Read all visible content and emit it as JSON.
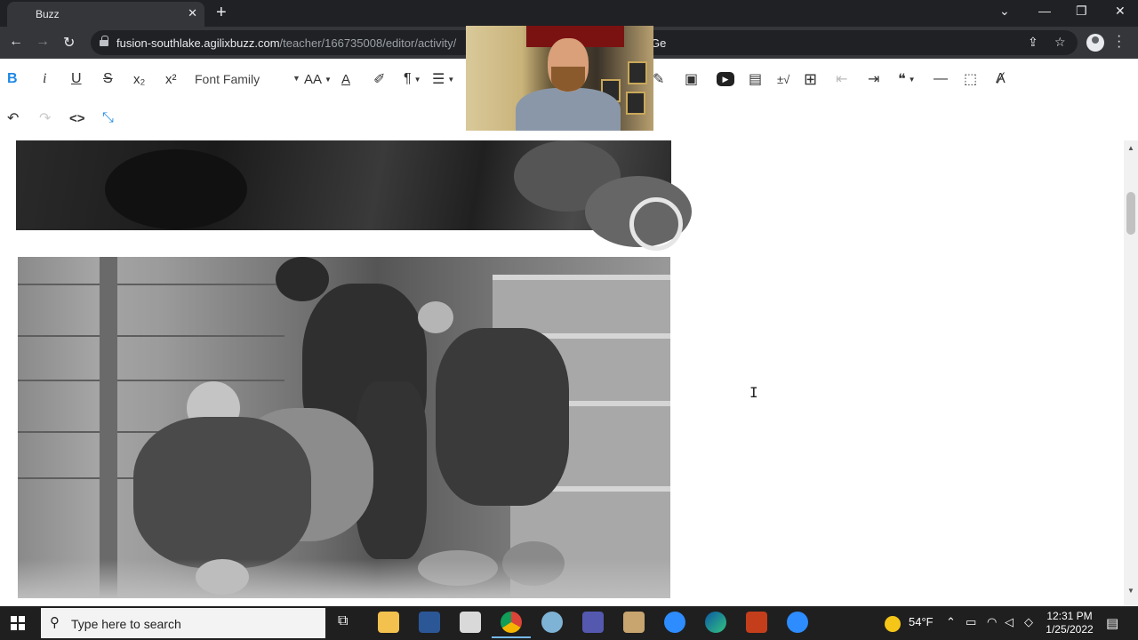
{
  "browser": {
    "tab_title": "Buzz",
    "tab_close": "✕",
    "new_tab": "+",
    "url_host": "fusion-southlake.agilixbuzz.com",
    "url_path": "/teacher/166735008/editor/activity/",
    "url_tail": "Ge",
    "window_controls": {
      "dropdown": "⌄",
      "minimize": "—",
      "restore": "❐",
      "close": "✕"
    }
  },
  "editor_toolbar": {
    "bold": "B",
    "italic": "i",
    "underline": "U",
    "strikethrough": "S",
    "subscript": "x₂",
    "superscript": "x²",
    "font_family": "Font Family",
    "font_size": "AA",
    "paragraph": "¶",
    "line_height": "☰",
    "undo": "↶",
    "redo": "↷",
    "code_view": "<>",
    "fullscreen": "⤡",
    "pencil": "✎",
    "insert_image": "▣",
    "insert_video": "▶",
    "insert_file": "▤",
    "math": "±√",
    "insert_table": "⊞",
    "outdent": "⇤",
    "indent": "⇥",
    "quote": "❝",
    "horizontal_line": "—",
    "select_all": "⬚",
    "clear_format": "Ⱥ"
  },
  "content": {
    "cursor": "I"
  },
  "taskbar": {
    "search_placeholder": "Type here to search",
    "temperature": "54°F",
    "time": "12:31 PM",
    "date": "1/25/2022"
  },
  "colors": {
    "chrome_dark": "#202124",
    "toolbar_active": "#1e88e5",
    "taskbar": "#1f1f1f"
  }
}
